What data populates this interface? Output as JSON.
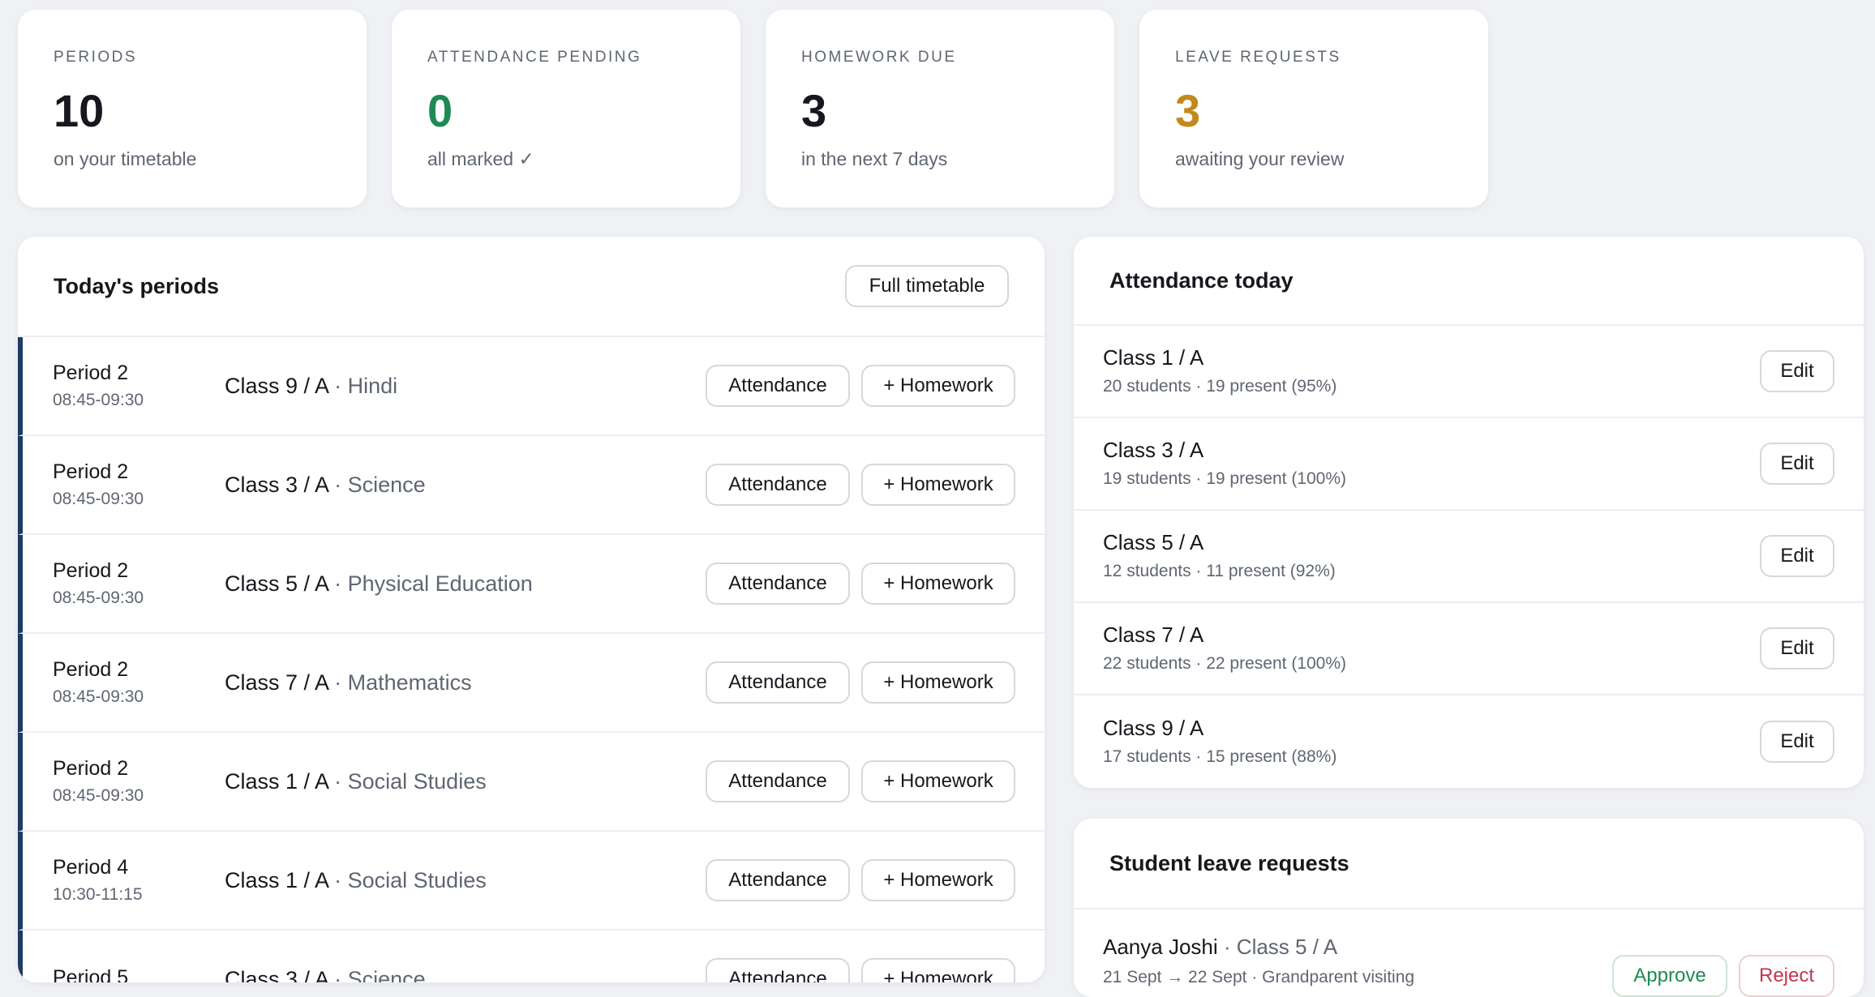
{
  "stats": [
    {
      "label": "PERIODS",
      "value": "10",
      "sub": "on your timetable",
      "color": "#16181d"
    },
    {
      "label": "ATTENDANCE PENDING",
      "value": "0",
      "sub": "all marked ✓",
      "color": "#1c8a52"
    },
    {
      "label": "HOMEWORK DUE",
      "value": "3",
      "sub": "in the next 7 days",
      "color": "#16181d"
    },
    {
      "label": "LEAVE REQUESTS",
      "value": "3",
      "sub": "awaiting your review",
      "color": "#c28a1b"
    }
  ],
  "periods": {
    "title": "Today's periods",
    "full_timetable_label": "Full timetable",
    "attendance_label": "Attendance",
    "homework_label": "+ Homework",
    "separator": "·",
    "rows": [
      {
        "period": "Period 2",
        "time": "08:45-09:30",
        "class": "Class 9 / A",
        "subject": "Hindi"
      },
      {
        "period": "Period 2",
        "time": "08:45-09:30",
        "class": "Class 3 / A",
        "subject": "Science"
      },
      {
        "period": "Period 2",
        "time": "08:45-09:30",
        "class": "Class 5 / A",
        "subject": "Physical Education"
      },
      {
        "period": "Period 2",
        "time": "08:45-09:30",
        "class": "Class 7 / A",
        "subject": "Mathematics"
      },
      {
        "period": "Period 2",
        "time": "08:45-09:30",
        "class": "Class 1 / A",
        "subject": "Social Studies"
      },
      {
        "period": "Period 4",
        "time": "10:30-11:15",
        "class": "Class 1 / A",
        "subject": "Social Studies"
      },
      {
        "period": "Period 5",
        "time": "",
        "class": "Class 3 / A",
        "subject": "Science"
      }
    ]
  },
  "attendance": {
    "title": "Attendance today",
    "edit_label": "Edit",
    "rows": [
      {
        "class": "Class 1 / A",
        "stats": "20 students · 19 present (95%)"
      },
      {
        "class": "Class 3 / A",
        "stats": "19 students · 19 present (100%)"
      },
      {
        "class": "Class 5 / A",
        "stats": "12 students · 11 present (92%)"
      },
      {
        "class": "Class 7 / A",
        "stats": "22 students · 22 present (100%)"
      },
      {
        "class": "Class 9 / A",
        "stats": "17 students · 15 present (88%)"
      }
    ]
  },
  "leave": {
    "title": "Student leave requests",
    "approve_label": "Approve",
    "reject_label": "Reject",
    "rows": [
      {
        "name": "Aanya Joshi",
        "class": "Class 5 / A",
        "detail": "21 Sept → 22 Sept · Grandparent visiting"
      }
    ]
  }
}
